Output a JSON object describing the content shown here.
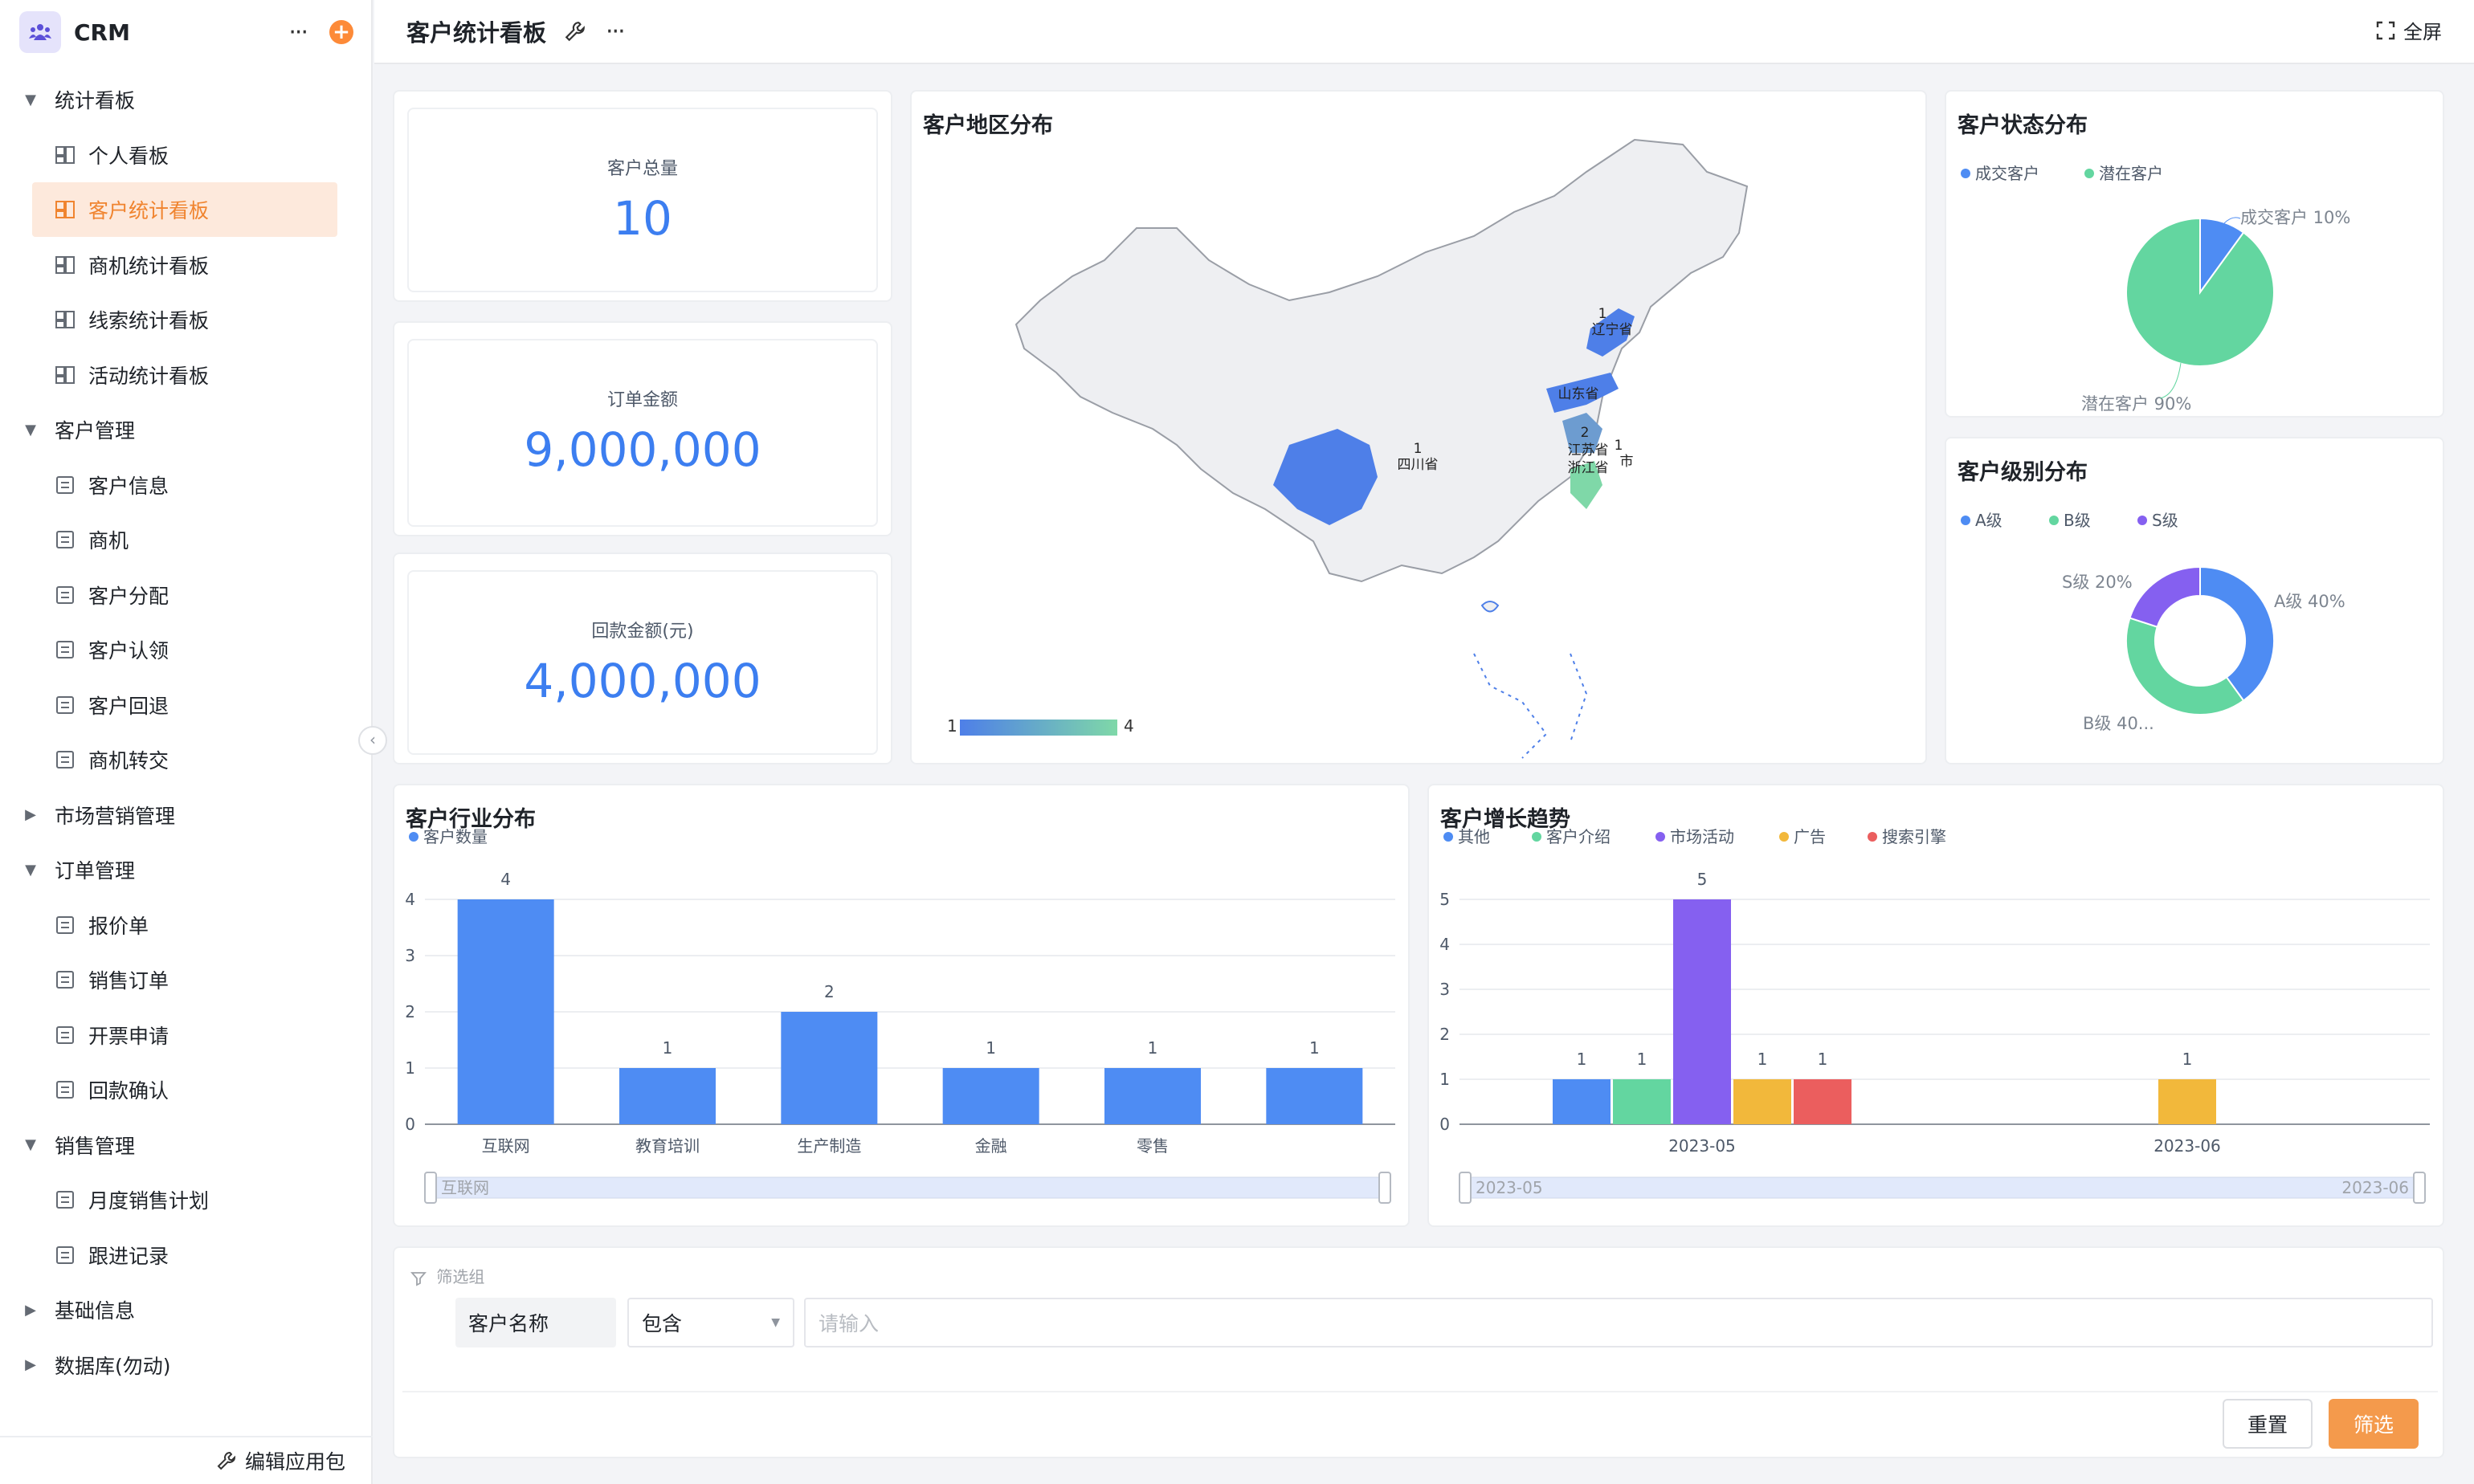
{
  "app": {
    "name": "CRM"
  },
  "page": {
    "title": "客户统计看板",
    "fullscreen_label": "全屏"
  },
  "sidebar": {
    "items": [
      {
        "label": "统计看板",
        "type": "group",
        "expanded": true
      },
      {
        "label": "个人看板",
        "type": "child",
        "icon": "dashboard-icon"
      },
      {
        "label": "客户统计看板",
        "type": "child",
        "icon": "dashboard-icon",
        "active": true
      },
      {
        "label": "商机统计看板",
        "type": "child",
        "icon": "dashboard-icon"
      },
      {
        "label": "线索统计看板",
        "type": "child",
        "icon": "dashboard-icon"
      },
      {
        "label": "活动统计看板",
        "type": "child",
        "icon": "dashboard-icon"
      },
      {
        "label": "客户管理",
        "type": "group",
        "expanded": true
      },
      {
        "label": "客户信息",
        "type": "child",
        "icon": "form-icon"
      },
      {
        "label": "商机",
        "type": "child",
        "icon": "form-icon"
      },
      {
        "label": "客户分配",
        "type": "child",
        "icon": "form-icon"
      },
      {
        "label": "客户认领",
        "type": "child",
        "icon": "form-icon"
      },
      {
        "label": "客户回退",
        "type": "child",
        "icon": "form-icon"
      },
      {
        "label": "商机转交",
        "type": "child",
        "icon": "form-icon"
      },
      {
        "label": "市场营销管理",
        "type": "group",
        "expanded": false
      },
      {
        "label": "订单管理",
        "type": "group",
        "expanded": true
      },
      {
        "label": "报价单",
        "type": "child",
        "icon": "form-icon"
      },
      {
        "label": "销售订单",
        "type": "child",
        "icon": "form-icon"
      },
      {
        "label": "开票申请",
        "type": "child",
        "icon": "form-icon"
      },
      {
        "label": "回款确认",
        "type": "child",
        "icon": "form-icon"
      },
      {
        "label": "销售管理",
        "type": "group",
        "expanded": true
      },
      {
        "label": "月度销售计划",
        "type": "child",
        "icon": "form-icon"
      },
      {
        "label": "跟进记录",
        "type": "child",
        "icon": "form-icon"
      },
      {
        "label": "基础信息",
        "type": "group",
        "expanded": false
      },
      {
        "label": "数据库(勿动)",
        "type": "group",
        "expanded": false
      }
    ],
    "footer_label": "编辑应用包"
  },
  "stats": [
    {
      "label": "客户总量",
      "value": "10"
    },
    {
      "label": "订单金额",
      "value": "9,000,000"
    },
    {
      "label": "回款金额(元)",
      "value": "4,000,000"
    }
  ],
  "map": {
    "title": "客户地区分布",
    "regions": [
      {
        "name": "辽宁省",
        "value": 1
      },
      {
        "name": "山东省",
        "value": ""
      },
      {
        "name": "江苏省",
        "value": 2
      },
      {
        "name": "市",
        "value": 1
      },
      {
        "name": "浙江省",
        "value": ""
      },
      {
        "name": "四川省",
        "value": 1
      }
    ],
    "visual_map_min": "1",
    "visual_map_max": "4"
  },
  "status_pie": {
    "title": "客户状态分布",
    "chart_data": {
      "type": "pie",
      "categories": [
        "成交客户",
        "潜在客户"
      ],
      "values": [
        10,
        90
      ],
      "labels": [
        "成交客户 10%",
        "潜在客户 90%"
      ],
      "colors": [
        "#4e8cf3",
        "#63d6a0"
      ]
    }
  },
  "level_donut": {
    "title": "客户级别分布",
    "chart_data": {
      "type": "pie",
      "categories": [
        "A级",
        "B级",
        "S级"
      ],
      "values": [
        40,
        40,
        20
      ],
      "labels": [
        "A级 40%",
        "B级 40...",
        "S级 20%"
      ],
      "colors": [
        "#4e8cf3",
        "#63d6a0",
        "#8560f0"
      ]
    }
  },
  "industry_chart": {
    "title": "客户行业分布",
    "slider_label": "互联网",
    "chart_data": {
      "type": "bar",
      "categories": [
        "互联网",
        "教育培训",
        "生产制造",
        "金融",
        "零售",
        ""
      ],
      "series": [
        {
          "name": "客户数量",
          "values": [
            4,
            1,
            2,
            1,
            1,
            1
          ],
          "color": "#4e8cf3"
        }
      ],
      "ylim": [
        0,
        4
      ],
      "yticks": [
        "0",
        "1",
        "2",
        "3",
        "4"
      ]
    }
  },
  "growth_chart": {
    "title": "客户增长趋势",
    "slider_start": "2023-05",
    "slider_end": "2023-06",
    "chart_data": {
      "type": "bar",
      "categories": [
        "2023-05",
        "2023-06"
      ],
      "series": [
        {
          "name": "其他",
          "values": [
            1,
            0
          ],
          "color": "#4e8cf3"
        },
        {
          "name": "客户介绍",
          "values": [
            1,
            0
          ],
          "color": "#63d6a0"
        },
        {
          "name": "市场活动",
          "values": [
            5,
            0
          ],
          "color": "#8560f0"
        },
        {
          "name": "广告",
          "values": [
            1,
            1
          ],
          "color": "#f2b83b"
        },
        {
          "name": "搜索引擎",
          "values": [
            1,
            0
          ],
          "color": "#eb5e5e"
        }
      ],
      "ylim": [
        0,
        5
      ],
      "yticks": [
        "0",
        "1",
        "2",
        "3",
        "4",
        "5"
      ]
    }
  },
  "filter": {
    "group_label": "筛选组",
    "field_label": "客户名称",
    "operator": "包含",
    "placeholder": "请输入",
    "reset_label": "重置",
    "submit_label": "筛选"
  },
  "colors": {
    "accent": "#fd8a38",
    "primary": "#3c7ef0"
  }
}
